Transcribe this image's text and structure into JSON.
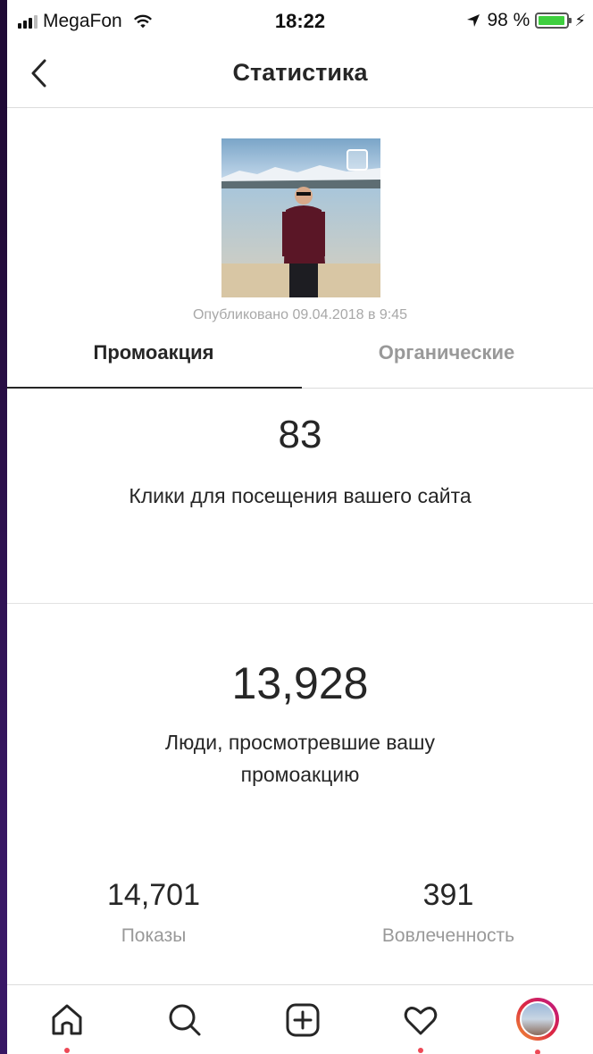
{
  "status_bar": {
    "carrier": "MegaFon",
    "time": "18:22",
    "battery_text": "98 %",
    "battery_level": 0.98
  },
  "header": {
    "title": "Статистика"
  },
  "post": {
    "published": "Опубликовано 09.04.2018 в 9:45"
  },
  "tabs": [
    {
      "label": "Промоакция",
      "active": true
    },
    {
      "label": "Органические",
      "active": false
    }
  ],
  "metrics": {
    "clicks": {
      "value": "83",
      "label": "Клики для посещения вашего сайта"
    },
    "reach": {
      "value": "13,928",
      "label": "Люди, просмотревшие вашу промоакцию"
    },
    "impressions": {
      "value": "14,701",
      "label": "Показы"
    },
    "engagement": {
      "value": "391",
      "label": "Вовлеченность"
    }
  },
  "tabbar": {
    "items": [
      "home-icon",
      "search-icon",
      "add-icon",
      "heart-icon",
      "profile-avatar"
    ]
  },
  "colors": {
    "accent_dot": "#ed4956",
    "text": "#262626",
    "muted": "#999999",
    "battery": "#3ecf3e"
  }
}
